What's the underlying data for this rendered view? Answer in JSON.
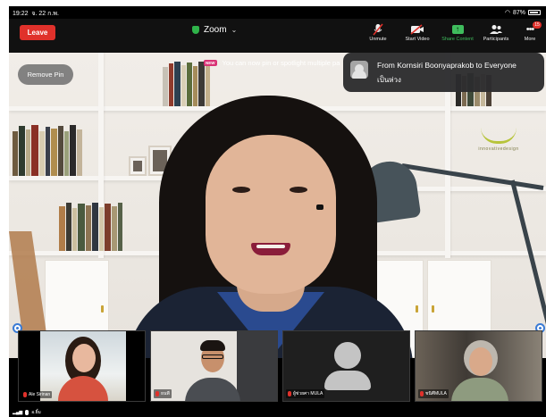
{
  "status_bar": {
    "time": "19:22",
    "date": "จ. 22 ก.พ.",
    "battery": "87%"
  },
  "toolbar": {
    "leave_label": "Leave",
    "meeting_title": "Zoom",
    "buttons": [
      {
        "label": "Unmute",
        "icon": "mic-muted-icon"
      },
      {
        "label": "Start Video",
        "icon": "video-off-icon"
      },
      {
        "label": "Share Content",
        "icon": "share-screen-icon"
      },
      {
        "label": "Participants",
        "icon": "participants-icon"
      },
      {
        "label": "More",
        "icon": "more-icon"
      }
    ],
    "more_badge": "15"
  },
  "main_video": {
    "remove_pin_label": "Remove Pin",
    "new_badge": "NEW",
    "notice_text": "You can now pin or spotlight multiple pa",
    "logo_text": "innovativedesign"
  },
  "chat_notification": {
    "title": "From Kornsiri Boonyaprakob to Everyone",
    "message": "เป็นห่วง"
  },
  "thumbnails": [
    {
      "name": "Ale Sirinan"
    },
    {
      "name": "ธนพี"
    },
    {
      "name": "ผู้ช่วยศา MULA"
    },
    {
      "name": "ชนิศีMULA"
    }
  ],
  "bottom_status": {
    "text": "อ.ยิ้ม"
  },
  "colors": {
    "leave": "#e0312b",
    "share": "#3fbd5d",
    "shield": "#2fb34a"
  }
}
